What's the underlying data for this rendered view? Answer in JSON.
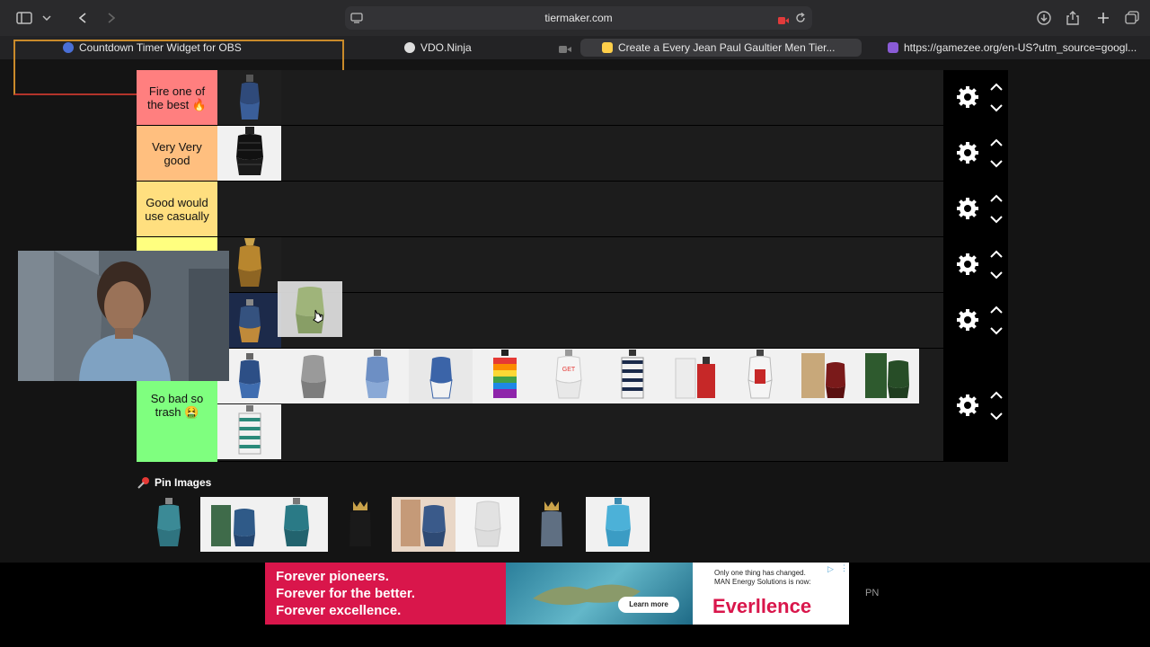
{
  "browser": {
    "url": "tiermaker.com",
    "tabs": [
      {
        "title": "Countdown Timer Widget for OBS"
      },
      {
        "title": "VDO.Ninja"
      },
      {
        "title": "Create a Every Jean Paul Gaultier Men Tier..."
      },
      {
        "title": "https://gamezee.org/en-US?utm_source=googl..."
      }
    ]
  },
  "tiers": [
    {
      "label": "Fire one of the best 🔥",
      "color": "#ff7f7f"
    },
    {
      "label": "Very Very good",
      "color": "#ffbf7f"
    },
    {
      "label": "Good would use casually",
      "color": "#ffdf7f"
    },
    {
      "label": "",
      "color": "#ffff7f"
    },
    {
      "label": "",
      "color": "#bfff7f"
    },
    {
      "label": "",
      "color": "#7fff7f"
    },
    {
      "label": "So bad so trash 🤮",
      "color": "#7fff7f"
    }
  ],
  "pin_images": {
    "label": "Pin Images"
  },
  "ad": {
    "line1": "Forever pioneers.",
    "line2": "Forever for the better.",
    "line3": "Forever excellence.",
    "notice": "Only one thing has changed. MAN Energy Solutions is now:",
    "brand": "Everllence",
    "cta": "Learn more",
    "side_text": "PN"
  },
  "colors": {
    "accent": "#d9164b",
    "gear": "#ffffff"
  }
}
